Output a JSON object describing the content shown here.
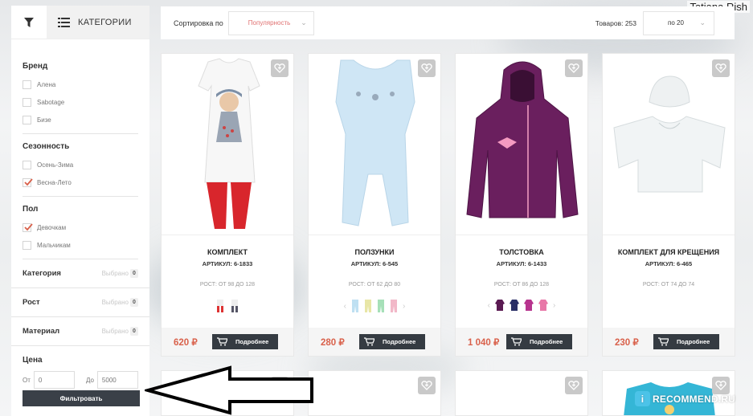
{
  "watermark": "Tatiana Rish",
  "recommend": {
    "icon": "i",
    "text": "RECOMMEND.RU"
  },
  "sidebar": {
    "tab_categories": "КАТЕГОРИИ",
    "brand": {
      "title": "Бренд",
      "items": [
        "Алена",
        "Sabotage",
        "Бизе"
      ]
    },
    "season": {
      "title": "Сезонность",
      "items": [
        "Осень-Зима",
        "Весна-Лето"
      ],
      "checked": [
        false,
        true
      ]
    },
    "gender": {
      "title": "Пол",
      "items": [
        "Девочкам",
        "Мальчикам"
      ],
      "checked": [
        true,
        false
      ]
    },
    "collapsibles": [
      {
        "label": "Категория",
        "selected": "Выбрано",
        "count": "0"
      },
      {
        "label": "Рост",
        "selected": "Выбрано",
        "count": "0"
      },
      {
        "label": "Материал",
        "selected": "Выбрано",
        "count": "0"
      }
    ],
    "price": {
      "title": "Цена",
      "from_label": "От",
      "from_value": "0",
      "to_label": "До",
      "to_value": "5000"
    },
    "filter_button": "Фильтровать"
  },
  "topbar": {
    "sort_label": "Сортировка по",
    "sort_value": "Популярность",
    "count_label": "Товаров: 253",
    "per_page": "по 20"
  },
  "products": [
    {
      "title": "КОМПЛЕКТ",
      "article": "АРТИКУЛ: 6-1833",
      "size": "РОСТ: ОТ 98 ДО 128",
      "price": "620 ₽",
      "button": "Подробнее"
    },
    {
      "title": "ПОЛЗУНКИ",
      "article": "АРТИКУЛ: 6-545",
      "size": "РОСТ: ОТ 62 ДО 80",
      "price": "280 ₽",
      "button": "Подробнее"
    },
    {
      "title": "ТОЛСТОВКА",
      "article": "АРТИКУЛ: 6-1433",
      "size": "РОСТ: ОТ 86 ДО 128",
      "price": "1 040 ₽",
      "button": "Подробнее"
    },
    {
      "title": "КОМПЛЕКТ ДЛЯ КРЕЩЕНИЯ",
      "article": "АРТИКУЛ: 6-465",
      "size": "РОСТ: ОТ 74 ДО 74",
      "price": "230 ₽",
      "button": "Подробнее"
    }
  ],
  "colors": {
    "price": "#d9614b",
    "dark_button": "#353b42",
    "sort_value": "#e07070"
  }
}
